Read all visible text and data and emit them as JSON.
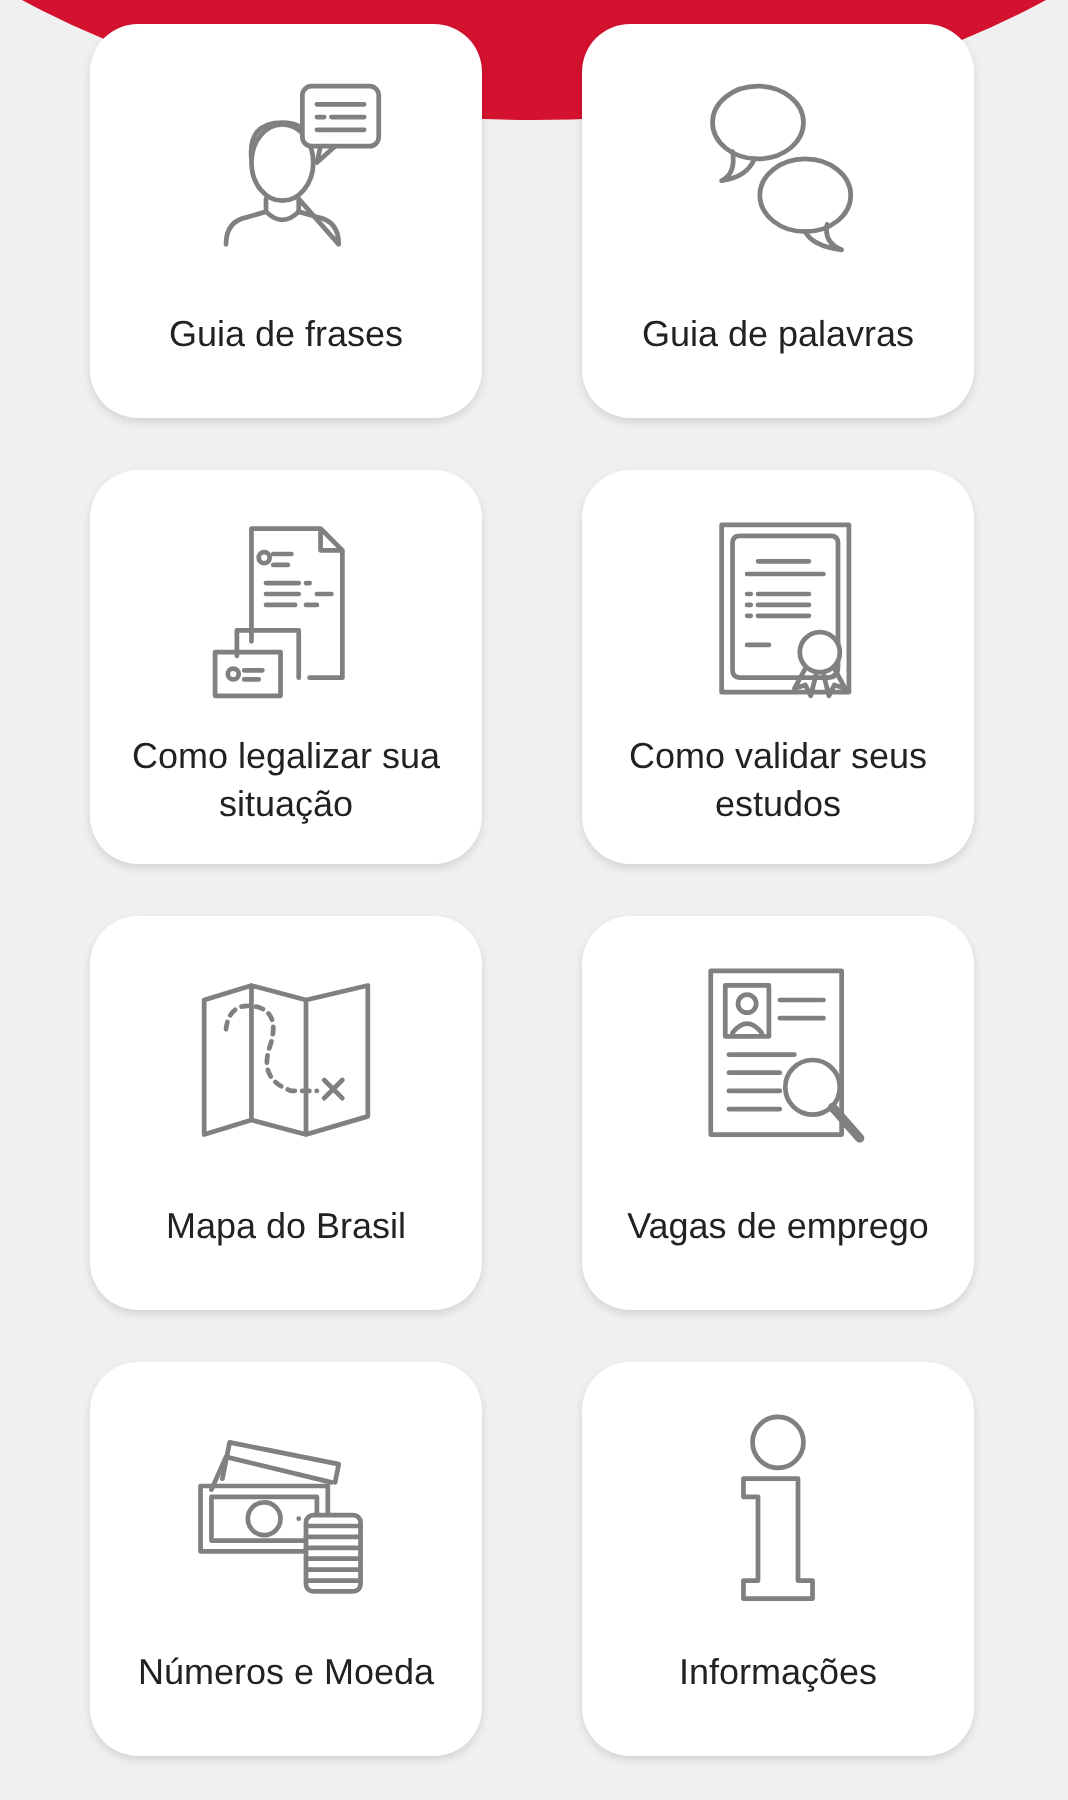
{
  "menu": [
    {
      "kind": "person-speech",
      "label": "Guia de frases"
    },
    {
      "kind": "speech-bubbles",
      "label": "Guia de palavras"
    },
    {
      "kind": "documents",
      "label": "Como legalizar sua situação"
    },
    {
      "kind": "certificate",
      "label": "Como validar seus estudos"
    },
    {
      "kind": "map",
      "label": "Mapa do Brasil"
    },
    {
      "kind": "resume-search",
      "label": "Vagas de emprego"
    },
    {
      "kind": "money",
      "label": "Números e Moeda"
    },
    {
      "kind": "info",
      "label": "Informações"
    }
  ]
}
